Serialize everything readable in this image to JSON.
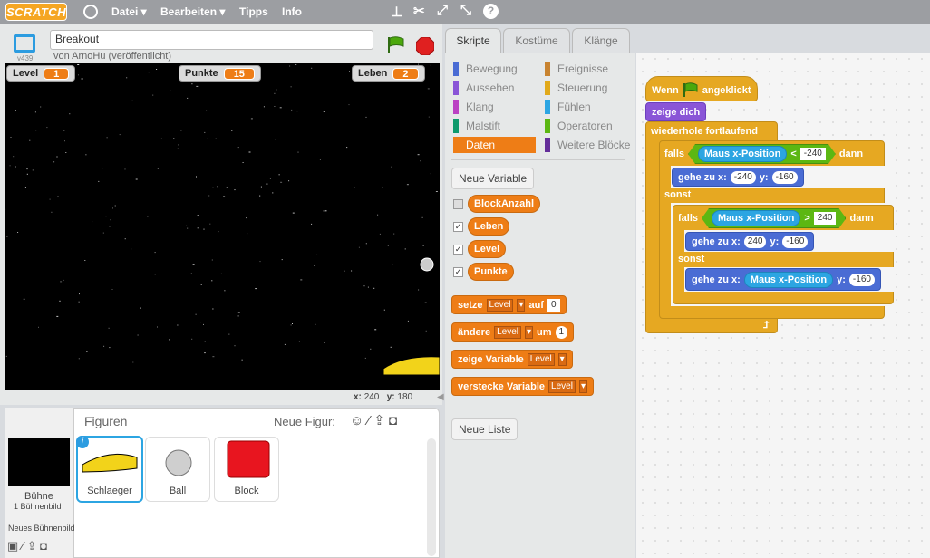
{
  "menu": {
    "logo": "SCRATCH",
    "items": [
      "Datei",
      "Bearbeiten",
      "Tipps",
      "Info"
    ]
  },
  "project": {
    "title": "Breakout",
    "author": "von ArnoHu (veröffentlicht)",
    "version": "v439"
  },
  "monitors": [
    {
      "label": "Level",
      "value": "1"
    },
    {
      "label": "Punkte",
      "value": "15"
    },
    {
      "label": "Leben",
      "value": "2"
    }
  ],
  "coords": {
    "x_label": "x:",
    "x": "240",
    "y_label": "y:",
    "y": "180"
  },
  "sprites": {
    "header": "Figuren",
    "new_label": "Neue Figur:",
    "stage_label": "Bühne",
    "stage_sub": "1 Bühnenbild",
    "new_backdrop": "Neues Bühnenbild",
    "items": [
      "Schlaeger",
      "Ball",
      "Block"
    ]
  },
  "tabs": [
    "Skripte",
    "Kostüme",
    "Klänge"
  ],
  "categories_left": [
    {
      "label": "Bewegung",
      "color": "#4a6cd4"
    },
    {
      "label": "Aussehen",
      "color": "#8a55d7"
    },
    {
      "label": "Klang",
      "color": "#bb42c3"
    },
    {
      "label": "Malstift",
      "color": "#0e9a6c"
    },
    {
      "label": "Daten",
      "color": "#ee7d16"
    }
  ],
  "categories_right": [
    {
      "label": "Ereignisse",
      "color": "#c88330"
    },
    {
      "label": "Steuerung",
      "color": "#e1a91a"
    },
    {
      "label": "Fühlen",
      "color": "#2ca5e2"
    },
    {
      "label": "Operatoren",
      "color": "#5cb712"
    },
    {
      "label": "Weitere Blöcke",
      "color": "#632d99"
    }
  ],
  "palette": {
    "new_variable": "Neue Variable",
    "variables": [
      {
        "name": "BlockAnzahl",
        "checked": false
      },
      {
        "name": "Leben",
        "checked": true
      },
      {
        "name": "Level",
        "checked": true
      },
      {
        "name": "Punkte",
        "checked": true
      }
    ],
    "set_block": {
      "a": "setze",
      "var": "Level",
      "b": "auf",
      "val": "0"
    },
    "change_block": {
      "a": "ändere",
      "var": "Level",
      "b": "um",
      "val": "1"
    },
    "show_block": {
      "a": "zeige Variable",
      "var": "Level"
    },
    "hide_block": {
      "a": "verstecke Variable",
      "var": "Level"
    },
    "new_list": "Neue Liste"
  },
  "script": {
    "hat_a": "Wenn",
    "hat_b": "angeklickt",
    "show": "zeige dich",
    "forever": "wiederhole fortlaufend",
    "if1": {
      "kw": "falls",
      "sensor": "Maus x-Position",
      "op": "<",
      "val": "-240",
      "then": "dann"
    },
    "go1": {
      "a": "gehe zu x:",
      "x": "-240",
      "b": "y:",
      "y": "-160"
    },
    "else1": "sonst",
    "if2": {
      "kw": "falls",
      "sensor": "Maus x-Position",
      "op": ">",
      "val": "240",
      "then": "dann"
    },
    "go2": {
      "a": "gehe zu x:",
      "x": "240",
      "b": "y:",
      "y": "-160"
    },
    "else2": "sonst",
    "go3": {
      "a": "gehe zu x:",
      "sensor": "Maus x-Position",
      "b": "y:",
      "y": "-160"
    }
  }
}
